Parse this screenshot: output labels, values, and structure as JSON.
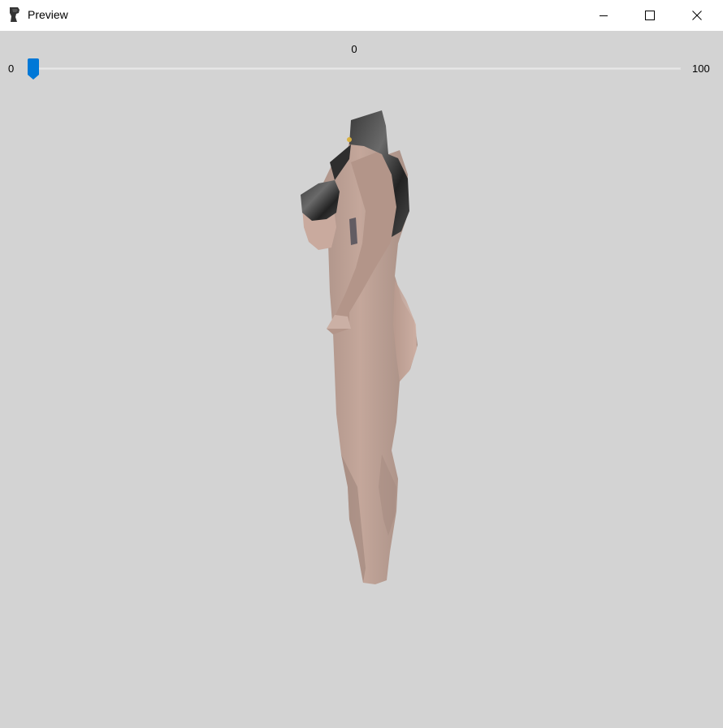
{
  "window": {
    "title": "Preview",
    "icon": "app-icon",
    "controls": [
      "minimize-icon",
      "maximize-icon",
      "close-icon"
    ]
  },
  "slider": {
    "value_label": "0",
    "min_label": "0",
    "max_label": "100",
    "value": 0,
    "min": 0,
    "max": 100,
    "accent_color": "#0078d7"
  },
  "viewport": {
    "background_color": "#d3d3d3",
    "content": "3d-model-preview"
  }
}
